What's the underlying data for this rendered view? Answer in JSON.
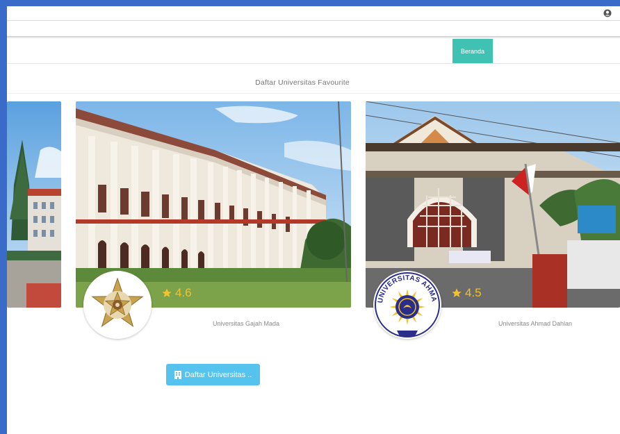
{
  "navbar": {
    "home_label": "Beranda"
  },
  "section": {
    "title": "Daftar Universitas Favourite"
  },
  "cards": [
    {
      "name": "Universitas Gajah Mada",
      "rating": "4.6"
    },
    {
      "name": "Universitas Ahmad Dahlan",
      "rating": "4.5",
      "logo_text": "UNIVERSITAS AHMAD DAHLAN"
    }
  ],
  "button": {
    "label": "Daftar Universitas .."
  },
  "icons": {
    "user": "user-circle-icon",
    "star": "star-icon",
    "building": "building-icon"
  },
  "colors": {
    "frame": "#3a6bc9",
    "nav_active": "#3fc1b4",
    "button": "#56c2ee",
    "rating": "#f1c232"
  }
}
